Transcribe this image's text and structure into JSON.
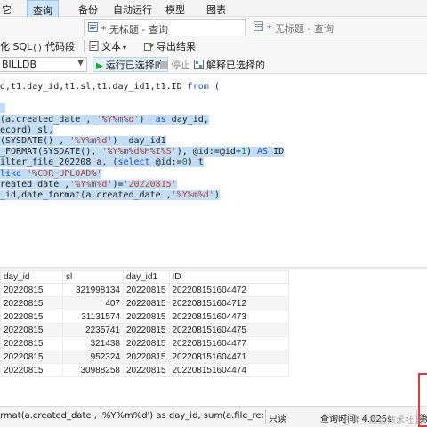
{
  "menubar": {
    "items": [
      "它",
      "查询",
      "备份",
      "自动运行",
      "模型",
      "图表"
    ],
    "active": "查询"
  },
  "tabs": [
    {
      "label": "* 无标题 - 查询",
      "active": true
    },
    {
      "label": "* 无标题 - 查询",
      "active": false
    }
  ],
  "toolbar": {
    "beautify_sql": "化 SQL",
    "code_snippet": "代码段",
    "text": "文本",
    "export_result": "导出结果"
  },
  "toolbar2": {
    "database": "BILLDB",
    "run_selected": "运行已选择的",
    "stop": "停止",
    "explain_selected": "解释已选择的"
  },
  "editor": {
    "lines": [
      [
        {
          "t": "d,t1.day_id,t1.sl,t1.day_id1,t1.ID ",
          "c": "",
          "s": false
        },
        {
          "t": "from",
          "c": "kw",
          "s": false
        },
        {
          "t": " (",
          "c": "",
          "s": false
        }
      ],
      [
        {
          "t": "",
          "c": "",
          "s": false
        }
      ],
      [
        {
          "t": " ",
          "c": "",
          "s": true
        }
      ],
      [
        {
          "t": "(a.created_date , ",
          "c": "",
          "s": true
        },
        {
          "t": "'%Y%m%d'",
          "c": "str",
          "s": true
        },
        {
          "t": ")  ",
          "c": "",
          "s": true
        },
        {
          "t": "as",
          "c": "kw",
          "s": true
        },
        {
          "t": " day_id,",
          "c": "",
          "s": true
        }
      ],
      [
        {
          "t": "ecord) sl,",
          "c": "",
          "s": true
        }
      ],
      [
        {
          "t": "(SYSDATE() , ",
          "c": "",
          "s": true
        },
        {
          "t": "'%Y%m%d'",
          "c": "str",
          "s": true
        },
        {
          "t": ")  day_id1",
          "c": "",
          "s": true
        }
      ],
      [
        {
          "t": "_FORMAT(SYSDATE(), ",
          "c": "",
          "s": true
        },
        {
          "t": "'%Y%m%d%H%I%S'",
          "c": "str",
          "s": true
        },
        {
          "t": "), @id:=@id+",
          "c": "",
          "s": true
        },
        {
          "t": "1",
          "c": "num",
          "s": true
        },
        {
          "t": ") ",
          "c": "",
          "s": true
        },
        {
          "t": "AS",
          "c": "kw",
          "s": true
        },
        {
          "t": " ID",
          "c": "",
          "s": true
        }
      ],
      [
        {
          "t": "ilter_file_202208 a, (",
          "c": "",
          "s": true
        },
        {
          "t": "select",
          "c": "kw",
          "s": true
        },
        {
          "t": " @id:=",
          "c": "",
          "s": true
        },
        {
          "t": "0",
          "c": "num",
          "s": true
        },
        {
          "t": ") t",
          "c": "",
          "s": true
        }
      ],
      [
        {
          "t": "like",
          "c": "kw",
          "s": true
        },
        {
          "t": " ",
          "c": "",
          "s": true
        },
        {
          "t": "'%CDR_UPLOAD%'",
          "c": "str",
          "s": true
        }
      ],
      [
        {
          "t": "reated_date ,",
          "c": "",
          "s": true
        },
        {
          "t": "'%Y%m%d'",
          "c": "str",
          "s": true
        },
        {
          "t": ")=",
          "c": "",
          "s": true
        },
        {
          "t": "'20220815'",
          "c": "str",
          "s": true
        }
      ],
      [
        {
          "t": "_id,date_format(a.created_date ,",
          "c": "",
          "s": true
        },
        {
          "t": "'%Y%m%d'",
          "c": "str",
          "s": true
        },
        {
          "t": ")",
          "c": "",
          "s": true
        }
      ]
    ]
  },
  "results": {
    "columns": [
      "day_id",
      "sl",
      "day_id1",
      "ID"
    ],
    "rows": [
      [
        "20220815",
        "321998134",
        "20220815",
        "202208151604472"
      ],
      [
        "20220815",
        "407",
        "20220815",
        "202208151604712"
      ],
      [
        "20220815",
        "31131574",
        "20220815",
        "202208151604473"
      ],
      [
        "20220815",
        "2235741",
        "20220815",
        "202208151604475"
      ],
      [
        "20220815",
        "321438",
        "20220815",
        "202208151604477"
      ],
      [
        "20220815",
        "952324",
        "20220815",
        "202208151604471"
      ],
      [
        "20220815",
        "30988258",
        "20220815",
        "202208151604474"
      ]
    ]
  },
  "status": {
    "sql_preview": "rmat(a.created_date , '%Y%m%d')  as day_id,     sum(a.file_record) s",
    "readonly": "只读",
    "query_time": "查询时间: 4.025s",
    "right_cut": "第"
  },
  "watermark": "@稀土掘金技术社区",
  "colors": {
    "selection": "#c3ddf6",
    "keyword": "#1a4fd6",
    "string": "#c0392b",
    "number": "#1a8a3a",
    "highlight_box": "#e53935"
  }
}
